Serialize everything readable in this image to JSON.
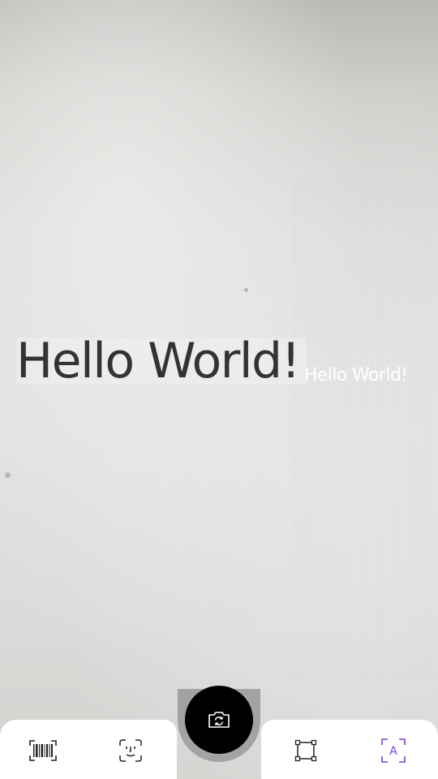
{
  "camera": {
    "detected_text": "Hello World!",
    "recognized_label": "Hello World!"
  },
  "toolbar": {
    "modes": [
      {
        "name": "barcode",
        "icon": "barcode-scan-icon",
        "selected": false
      },
      {
        "name": "face",
        "icon": "face-scan-icon",
        "selected": false
      },
      {
        "name": "object",
        "icon": "object-bounds-icon",
        "selected": false
      },
      {
        "name": "text",
        "icon": "text-recognition-icon",
        "selected": true,
        "icon_letter": "A"
      }
    ],
    "capture": {
      "icon": "switch-camera-icon"
    }
  },
  "colors": {
    "bar_background": "#ffffff",
    "capture_button": "#000000",
    "capture_ring": "#a3a3a3",
    "icon_default": "#222222",
    "icon_selected": "#7a3fd1",
    "label_text": "#ffffff"
  }
}
